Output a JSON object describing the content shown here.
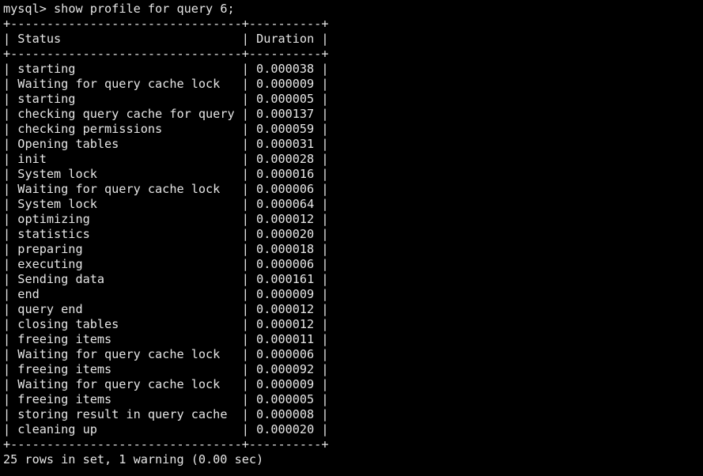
{
  "prompt": "mysql>",
  "command": "show profile for query 6;",
  "table": {
    "columns": [
      "Status",
      "Duration"
    ],
    "rows": [
      [
        "starting",
        "0.000038"
      ],
      [
        "Waiting for query cache lock",
        "0.000009"
      ],
      [
        "starting",
        "0.000005"
      ],
      [
        "checking query cache for query",
        "0.000137"
      ],
      [
        "checking permissions",
        "0.000059"
      ],
      [
        "Opening tables",
        "0.000031"
      ],
      [
        "init",
        "0.000028"
      ],
      [
        "System lock",
        "0.000016"
      ],
      [
        "Waiting for query cache lock",
        "0.000006"
      ],
      [
        "System lock",
        "0.000064"
      ],
      [
        "optimizing",
        "0.000012"
      ],
      [
        "statistics",
        "0.000020"
      ],
      [
        "preparing",
        "0.000018"
      ],
      [
        "executing",
        "0.000006"
      ],
      [
        "Sending data",
        "0.000161"
      ],
      [
        "end",
        "0.000009"
      ],
      [
        "query end",
        "0.000012"
      ],
      [
        "closing tables",
        "0.000012"
      ],
      [
        "freeing items",
        "0.000011"
      ],
      [
        "Waiting for query cache lock",
        "0.000006"
      ],
      [
        "freeing items",
        "0.000092"
      ],
      [
        "Waiting for query cache lock",
        "0.000009"
      ],
      [
        "freeing items",
        "0.000005"
      ],
      [
        "storing result in query cache",
        "0.000008"
      ],
      [
        "cleaning up",
        "0.000020"
      ]
    ]
  },
  "summary": "25 rows in set, 1 warning (0.00 sec)",
  "colors": {
    "background": "#000000",
    "text": "#e6e6e6"
  }
}
